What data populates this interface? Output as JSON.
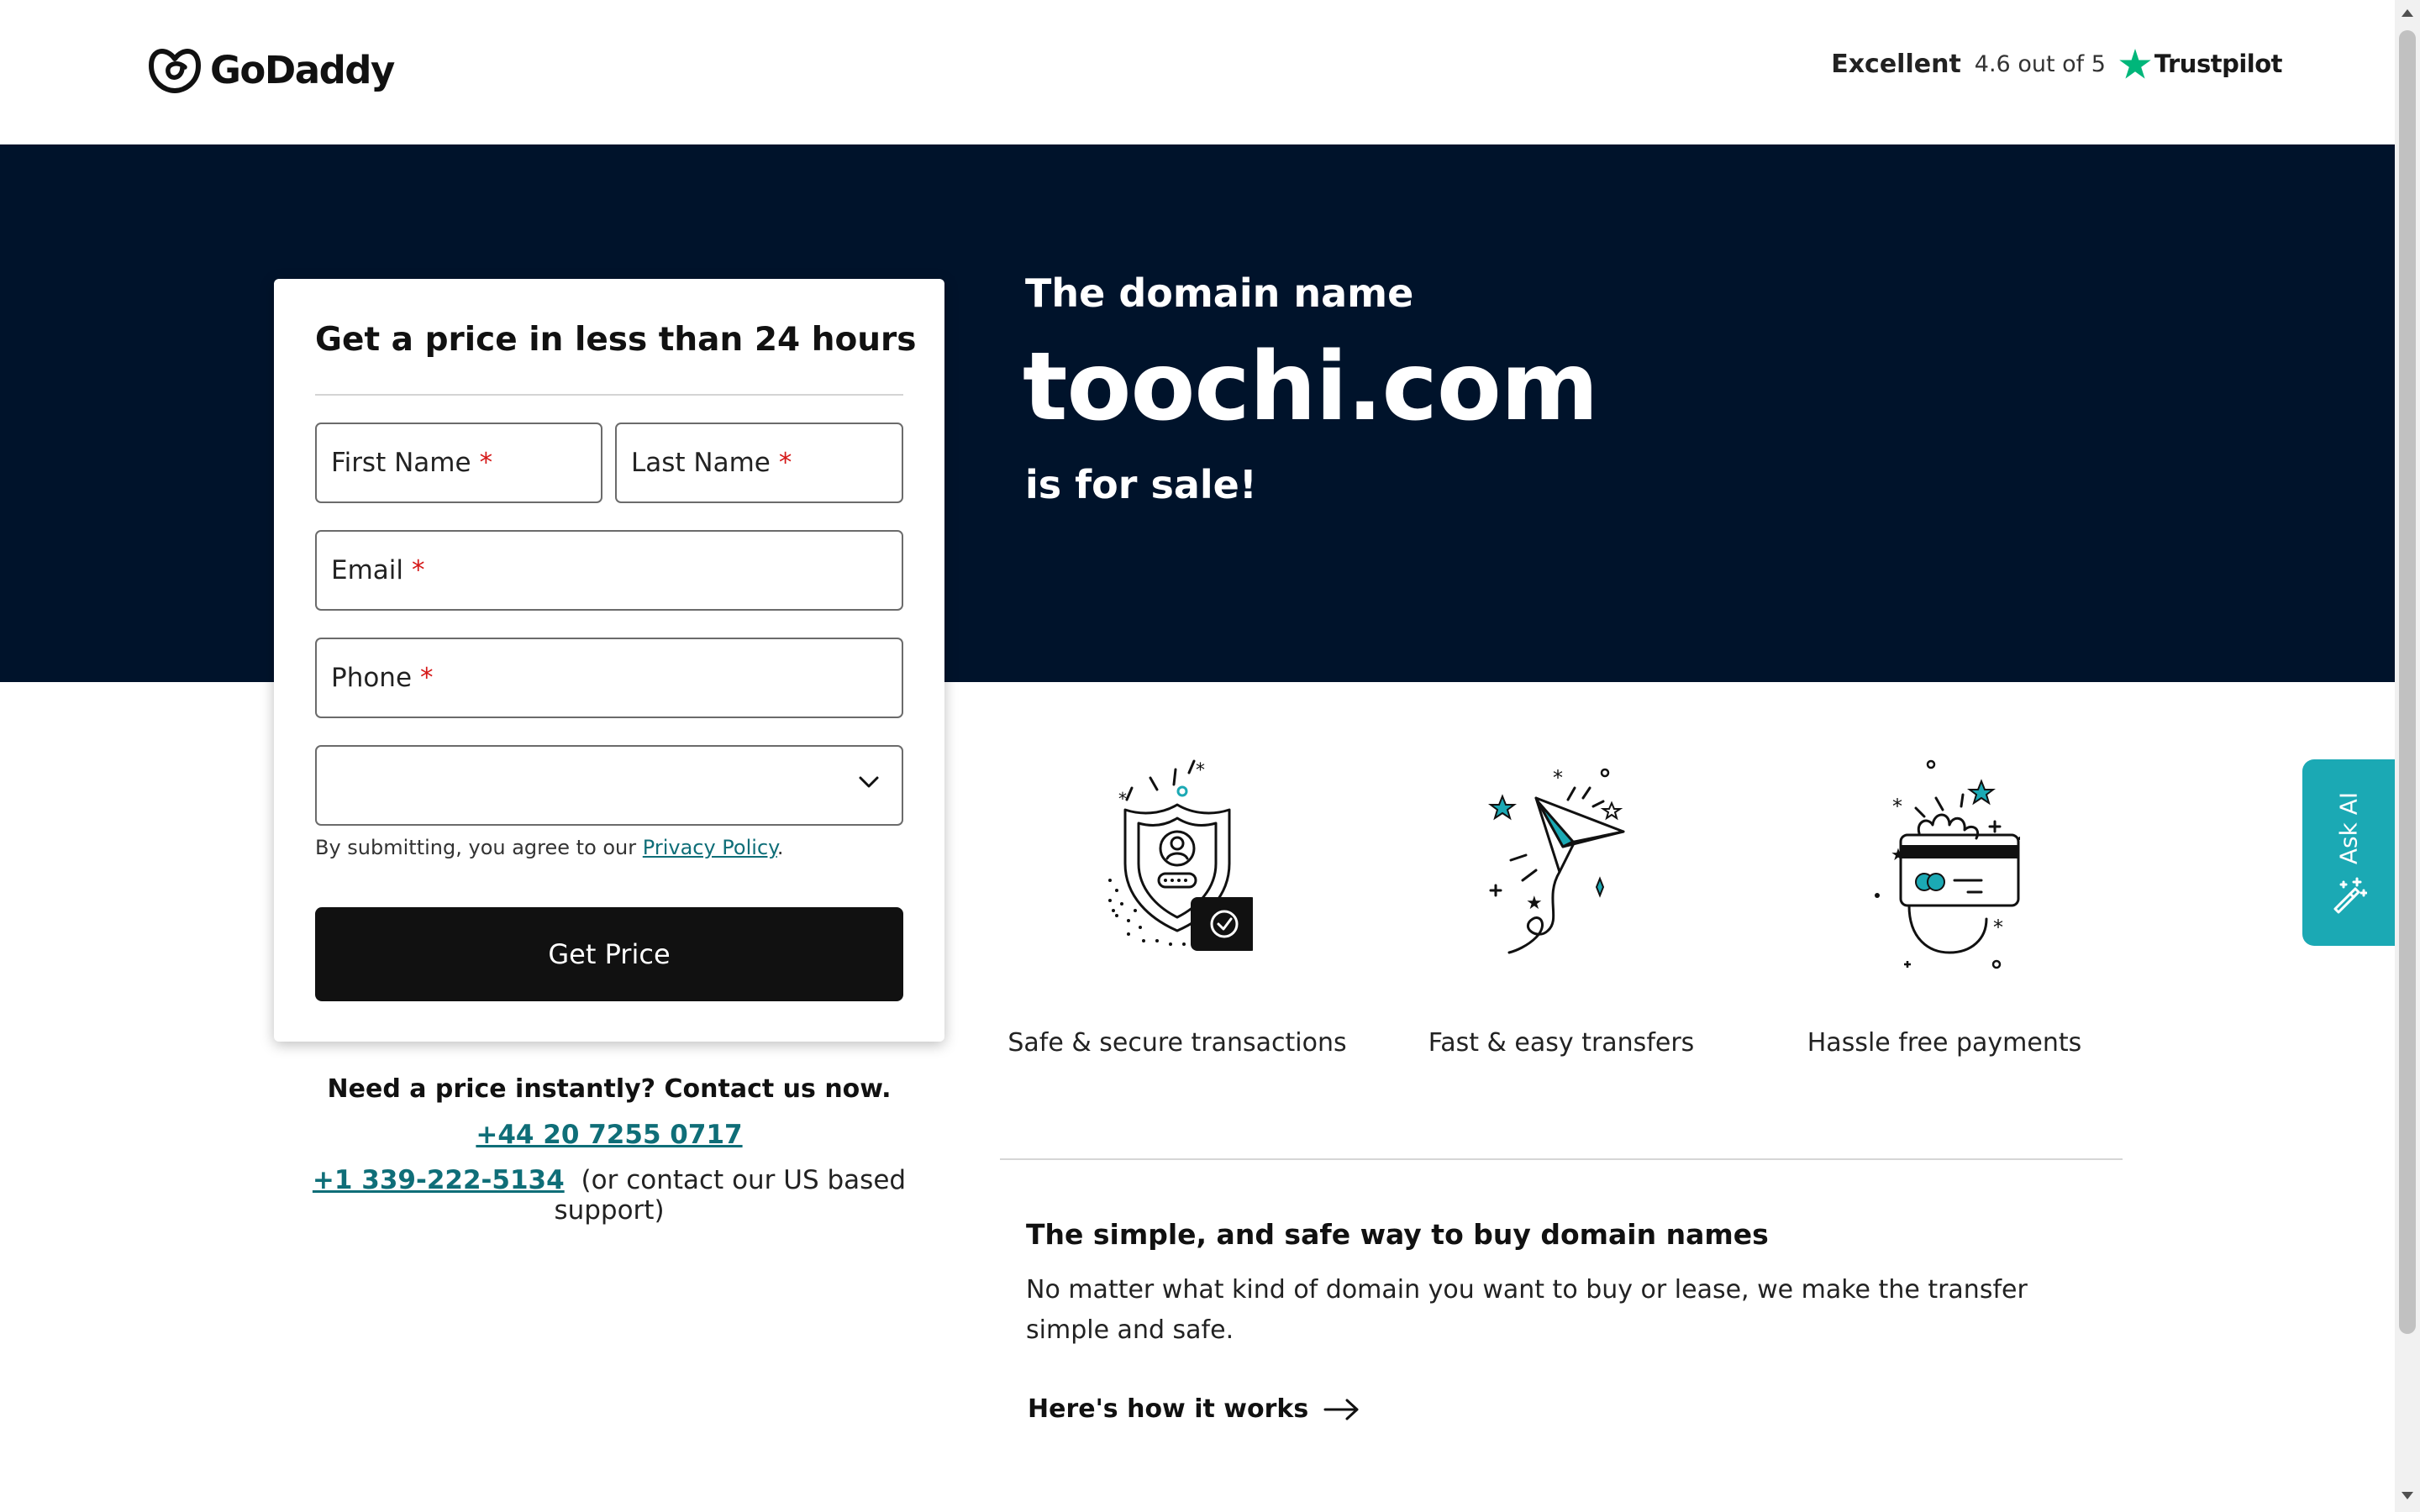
{
  "header": {
    "logo_text": "GoDaddy",
    "trust_word": "Excellent",
    "trust_score": "4.6 out of 5",
    "trust_brand": "Trustpilot"
  },
  "hero": {
    "pre": "The domain name",
    "domain": "toochi.com",
    "post": "is for sale!"
  },
  "form": {
    "title": "Get a price in less than 24 hours",
    "first_name_label": "First Name",
    "last_name_label": "Last Name",
    "email_label": "Email",
    "phone_label": "Phone",
    "required_mark": "*",
    "select_value": "",
    "consent_text": "By submitting, you agree to our",
    "consent_link": "Privacy Policy",
    "consent_end": ".",
    "submit_label": "Get Price"
  },
  "contact": {
    "question": "Need a price instantly? Contact us now.",
    "phone_uk": "+44 20 7255 0717",
    "phone_us": "+1 339-222-5134",
    "phone_us_note": "(or contact our US based support)"
  },
  "features": [
    {
      "caption": "Safe & secure transactions",
      "icon": "shield-icon"
    },
    {
      "caption": "Fast & easy transfers",
      "icon": "paper-plane-icon"
    },
    {
      "caption": "Hassle free payments",
      "icon": "card-in-hand-icon"
    }
  ],
  "info": {
    "title": "The simple, and safe way to buy domain names",
    "body": "No matter what kind of domain you want to buy or lease, we make the transfer simple and safe.",
    "link": "Here's how it works"
  },
  "ask_ai": {
    "label": "Ask AI"
  },
  "colors": {
    "hero_bg": "#00132b",
    "accent_teal": "#1ba9b4",
    "link_teal": "#0f6e78",
    "required_red": "#d51818",
    "button_bg": "#111111",
    "trustpilot_green": "#00b67a"
  }
}
